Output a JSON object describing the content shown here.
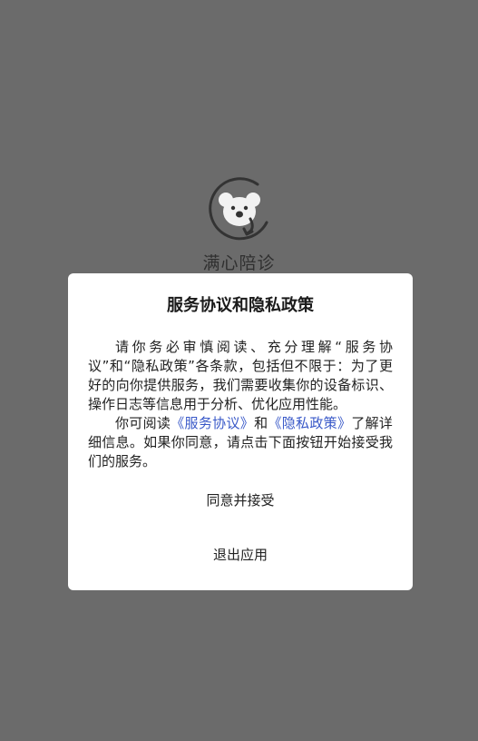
{
  "app": {
    "name": "满心陪诊"
  },
  "dialog": {
    "title": "服务协议和隐私政策",
    "paragraph1": "请你务必审慎阅读、充分理解“服务协议”和“隐私政策”各条款，包括但不限于：为了更好的向你提供服务，我们需要收集你的设备标识、操作日志等信息用于分析、优化应用性能。",
    "paragraph2_prefix": "你可阅读",
    "service_link": "《服务协议》",
    "paragraph2_and": "和",
    "privacy_link": "《隐私政策》",
    "paragraph2_suffix": "了解详细信息。如果你同意，请点击下面按钮开始接受我们的服务。",
    "accept_label": "同意并接受",
    "exit_label": "退出应用"
  },
  "colors": {
    "overlay": "#6b6b6b",
    "link": "#3858c8"
  },
  "icons": {
    "logo": "koala-face-icon"
  }
}
